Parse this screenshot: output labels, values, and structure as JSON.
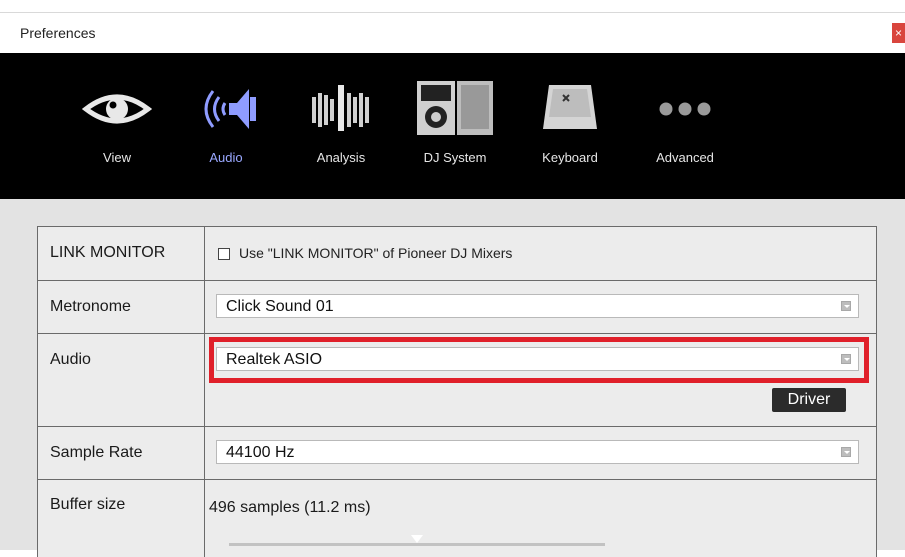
{
  "window": {
    "title": "Preferences",
    "close_glyph": "×"
  },
  "toolbar": {
    "items": [
      {
        "label": "View",
        "icon": "eye-icon",
        "active": false
      },
      {
        "label": "Audio",
        "icon": "speaker-icon",
        "active": true
      },
      {
        "label": "Analysis",
        "icon": "waveform-icon",
        "active": false
      },
      {
        "label": "DJ System",
        "icon": "dj-system-icon",
        "active": false
      },
      {
        "label": "Keyboard",
        "icon": "keyboard-key-icon",
        "active": false
      },
      {
        "label": "Advanced",
        "icon": "more-dots-icon",
        "active": false
      }
    ],
    "active_color": "#9aa8ff"
  },
  "settings": {
    "link_monitor": {
      "label": "LINK MONITOR",
      "checkbox_label": "Use \"LINK MONITOR\" of Pioneer DJ Mixers",
      "checked": false
    },
    "metronome": {
      "label": "Metronome",
      "value": "Click Sound 01"
    },
    "audio": {
      "label": "Audio",
      "value": "Realtek ASIO",
      "driver_button": "Driver",
      "highlight_color": "#e0202a"
    },
    "sample_rate": {
      "label": "Sample Rate",
      "value": "44100 Hz"
    },
    "buffer_size": {
      "label": "Buffer size",
      "value": "496 samples (11.2 ms)",
      "slider_fraction": 0.5
    }
  }
}
